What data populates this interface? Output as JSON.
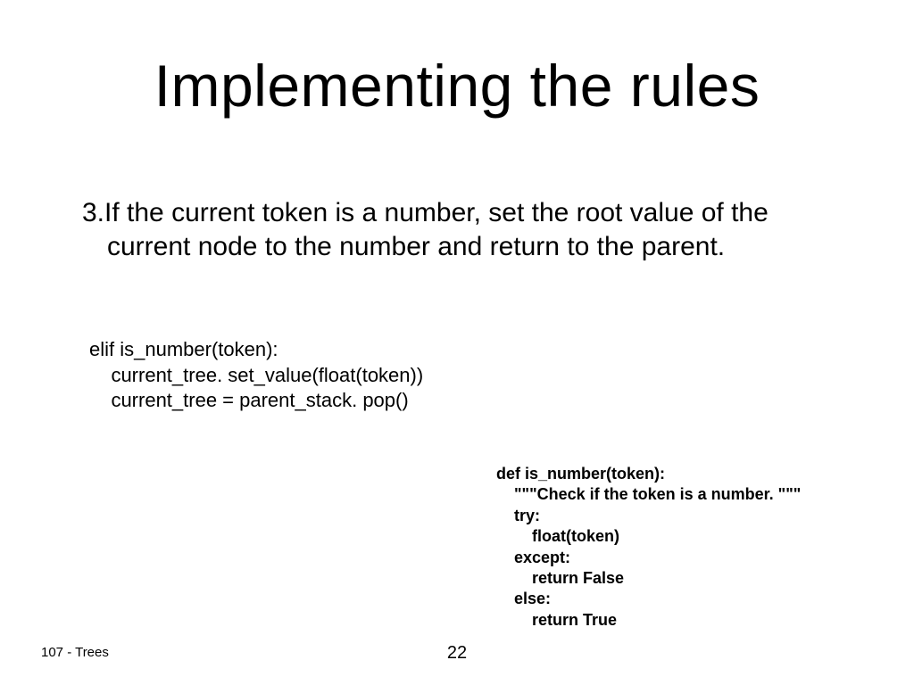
{
  "title": "Implementing the rules",
  "rule": {
    "number": "3.",
    "text": "If the current token is a number, set the root value of the current node to the number and return to the parent."
  },
  "code1": "elif is_number(token):\n    current_tree. set_value(float(token))\n    current_tree = parent_stack. pop()",
  "code2": "def is_number(token):\n    \"\"\"Check if the token is a number. \"\"\"\n    try:\n        float(token)\n    except:\n        return False\n    else:\n        return True",
  "footer": {
    "left": "107 - Trees",
    "page": "22"
  }
}
